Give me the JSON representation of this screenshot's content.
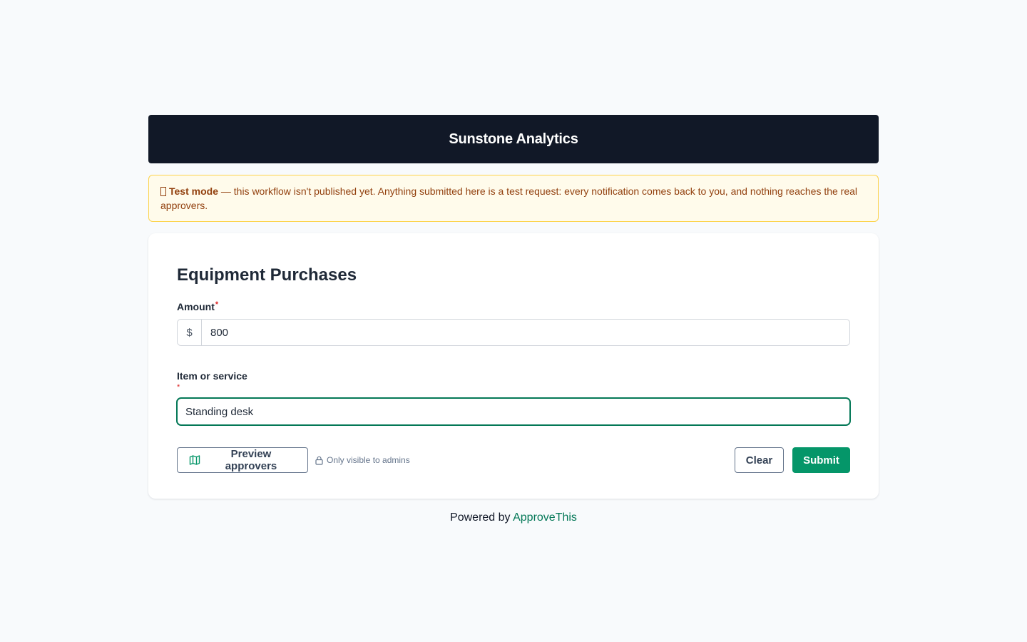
{
  "header": {
    "company_name": "Sunstone Analytics"
  },
  "banner": {
    "label": "Test mode",
    "message": " — this workflow isn't published yet. Anything submitted here is a test request: every notification comes back to you, and nothing reaches the real approvers."
  },
  "form": {
    "title": "Equipment Purchases",
    "required_marker": "*",
    "amount": {
      "label": "Amount",
      "prefix": "$",
      "value": "800"
    },
    "item": {
      "label": "Item or service",
      "value": "Standing desk"
    }
  },
  "actions": {
    "preview_label": "Preview approvers",
    "admins_note": "Only visible to admins",
    "clear_label": "Clear",
    "submit_label": "Submit"
  },
  "footer": {
    "prefix": "Powered by ",
    "link_text": "ApproveThis"
  },
  "icons": {
    "banner": "warning-icon",
    "preview": "map-icon",
    "admins": "lock-icon"
  },
  "colors": {
    "primary": "#059669",
    "header_bg": "#111827",
    "banner_bg": "#fffbeb",
    "banner_text": "#92400e",
    "required": "#dc2626"
  }
}
